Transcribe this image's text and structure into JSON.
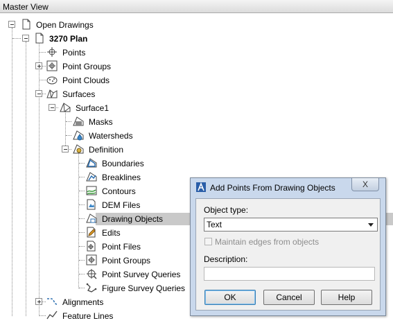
{
  "window": {
    "title": "Master View"
  },
  "tree": {
    "open_drawings": "Open Drawings",
    "drawing": "3270 Plan",
    "points": "Points",
    "point_groups": "Point Groups",
    "point_clouds": "Point Clouds",
    "surfaces": "Surfaces",
    "surface1": "Surface1",
    "masks": "Masks",
    "watersheds": "Watersheds",
    "definition": "Definition",
    "boundaries": "Boundaries",
    "breaklines": "Breaklines",
    "contours": "Contours",
    "dem_files": "DEM Files",
    "drawing_objects": "Drawing Objects",
    "edits": "Edits",
    "point_files": "Point Files",
    "def_point_groups": "Point Groups",
    "point_survey_queries": "Point Survey Queries",
    "figure_survey_queries": "Figure Survey Queries",
    "alignments": "Alignments",
    "feature_lines": "Feature Lines"
  },
  "dialog": {
    "title": "Add Points From Drawing Objects",
    "close_glyph": "X",
    "object_type_label": "Object type:",
    "object_type_value": "Text",
    "maintain_edges_label": "Maintain edges from objects",
    "description_label": "Description:",
    "description_value": "",
    "ok_label": "OK",
    "cancel_label": "Cancel",
    "help_label": "Help"
  }
}
